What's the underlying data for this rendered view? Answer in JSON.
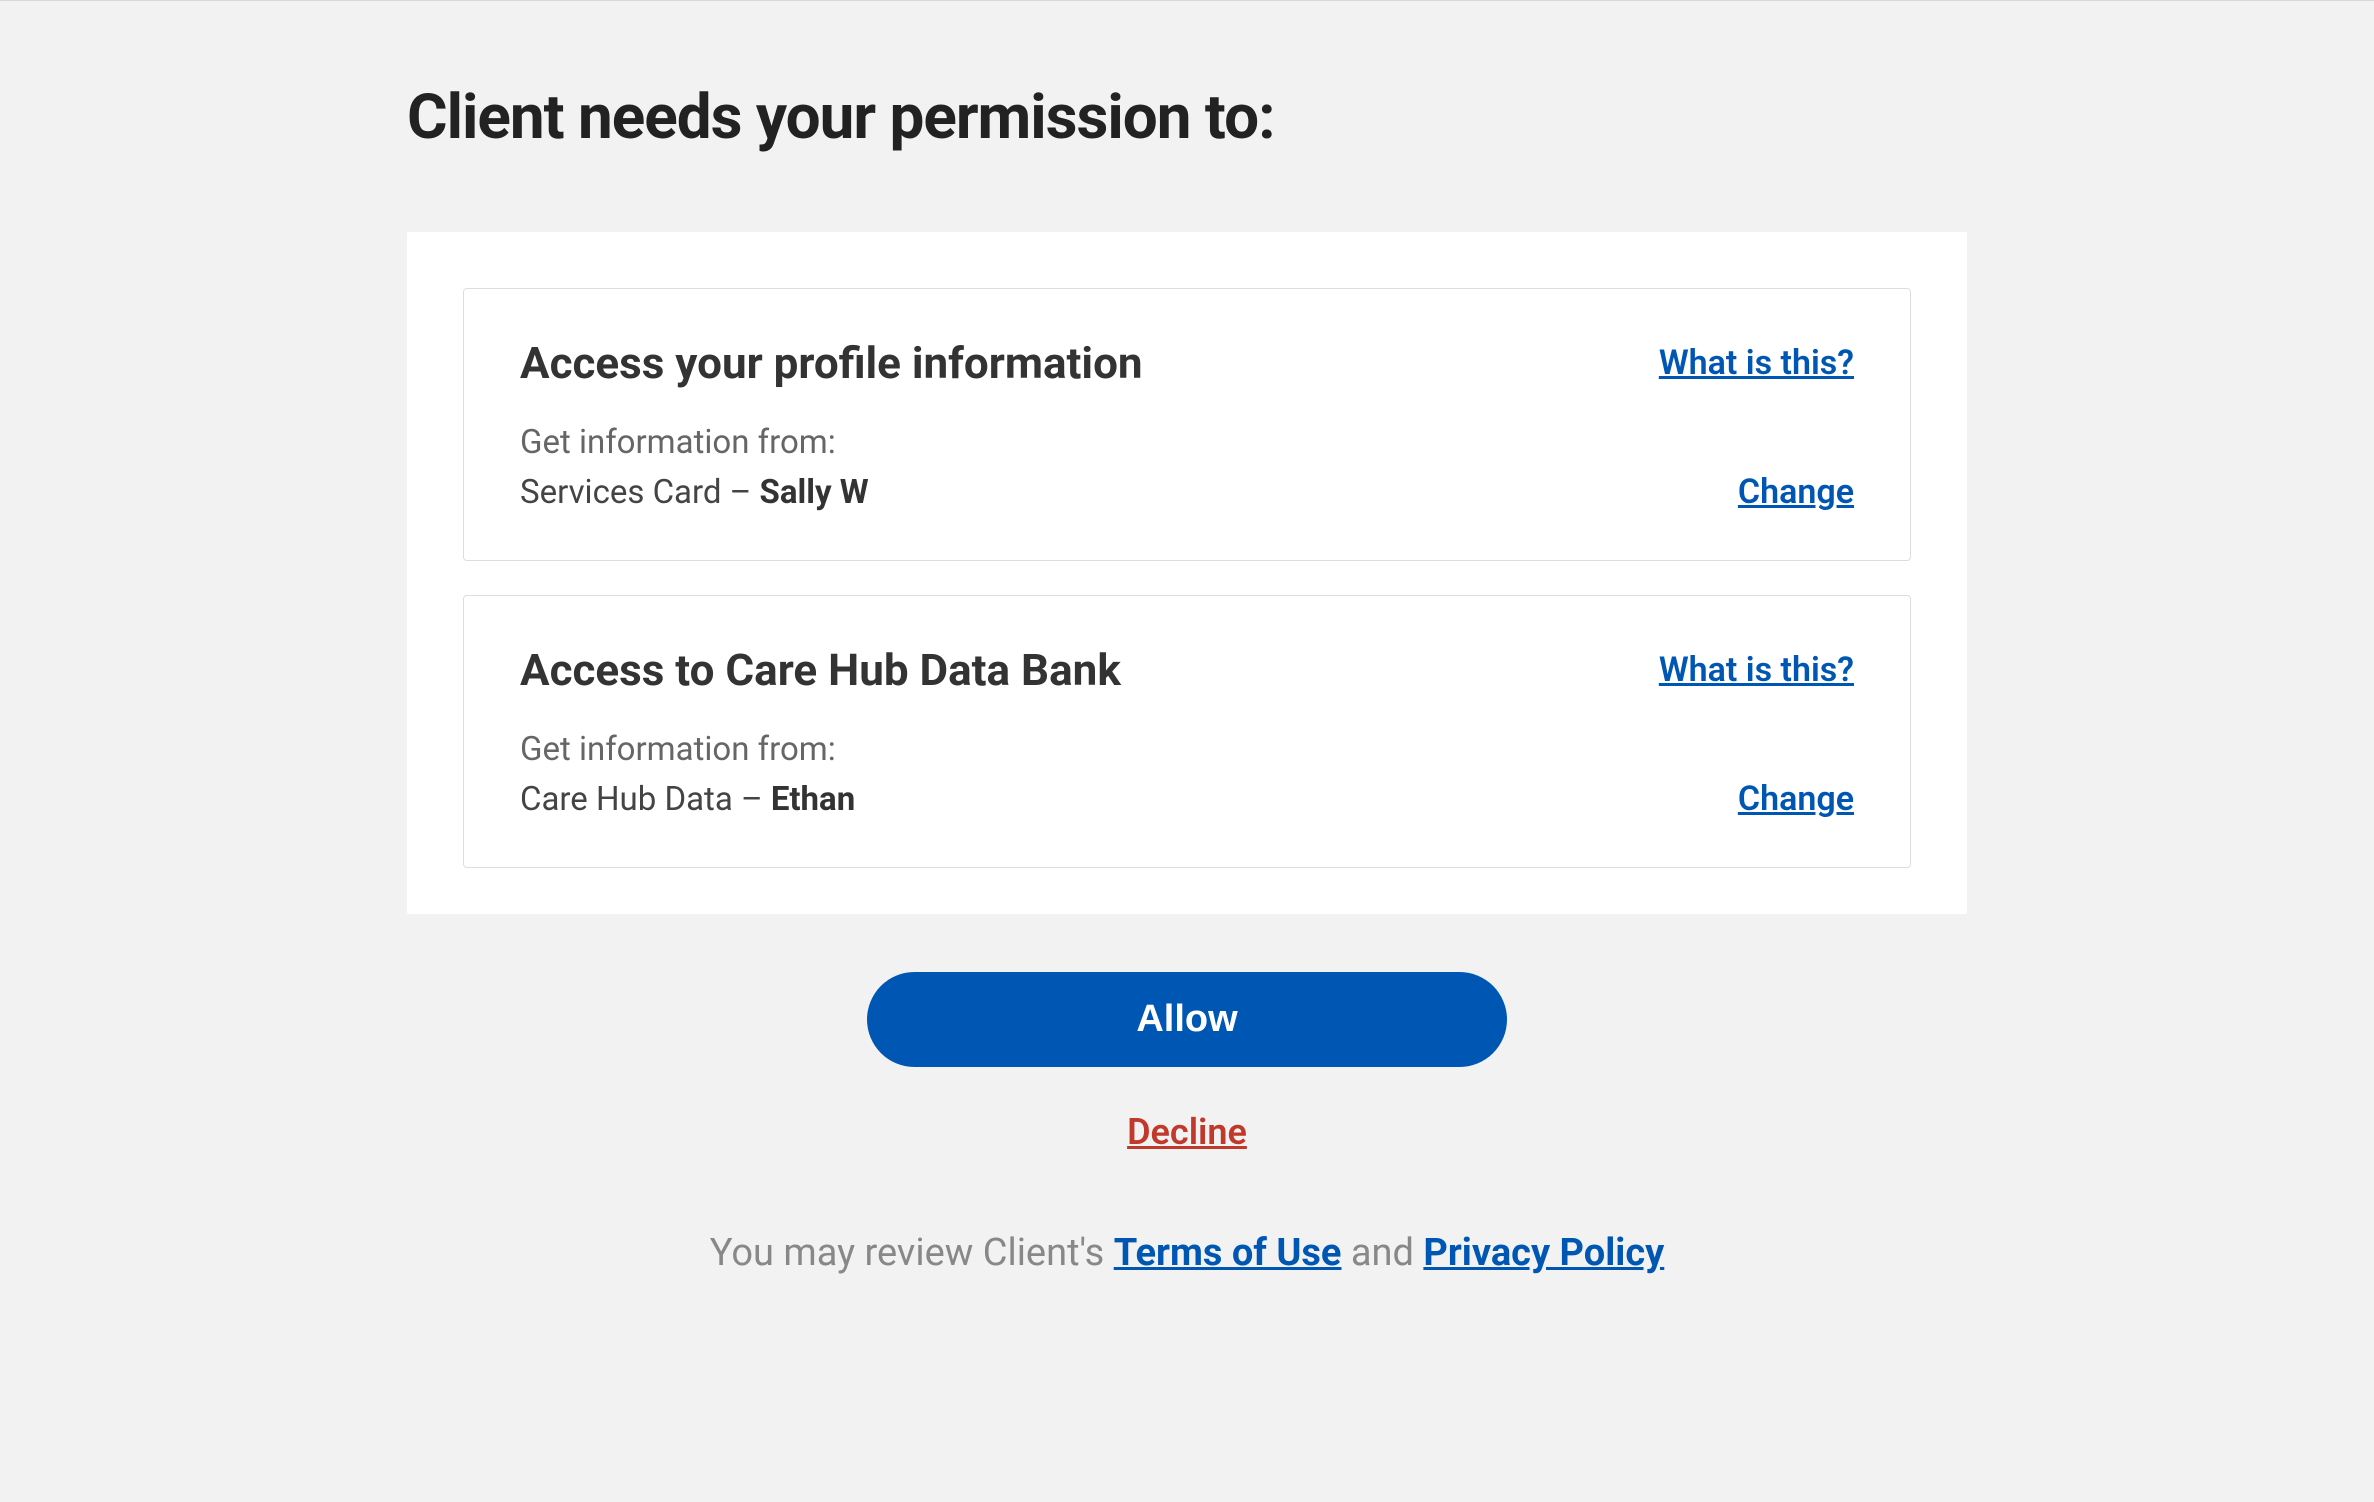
{
  "page": {
    "title": "Client needs your permission to:"
  },
  "permissions": [
    {
      "title": "Access your profile information",
      "what_is_this": "What is this?",
      "info_label": "Get information from:",
      "source_prefix": "Services Card – ",
      "source_name": "Sally W",
      "change_label": "Change"
    },
    {
      "title": "Access to Care Hub Data Bank",
      "what_is_this": "What is this?",
      "info_label": "Get information from:",
      "source_prefix": "Care Hub Data – ",
      "source_name": "Ethan",
      "change_label": "Change"
    }
  ],
  "actions": {
    "allow": "Allow",
    "decline": "Decline"
  },
  "footer": {
    "prefix": "You may review Client's ",
    "terms": "Terms of Use",
    "and": " and ",
    "privacy": "Privacy Policy"
  }
}
